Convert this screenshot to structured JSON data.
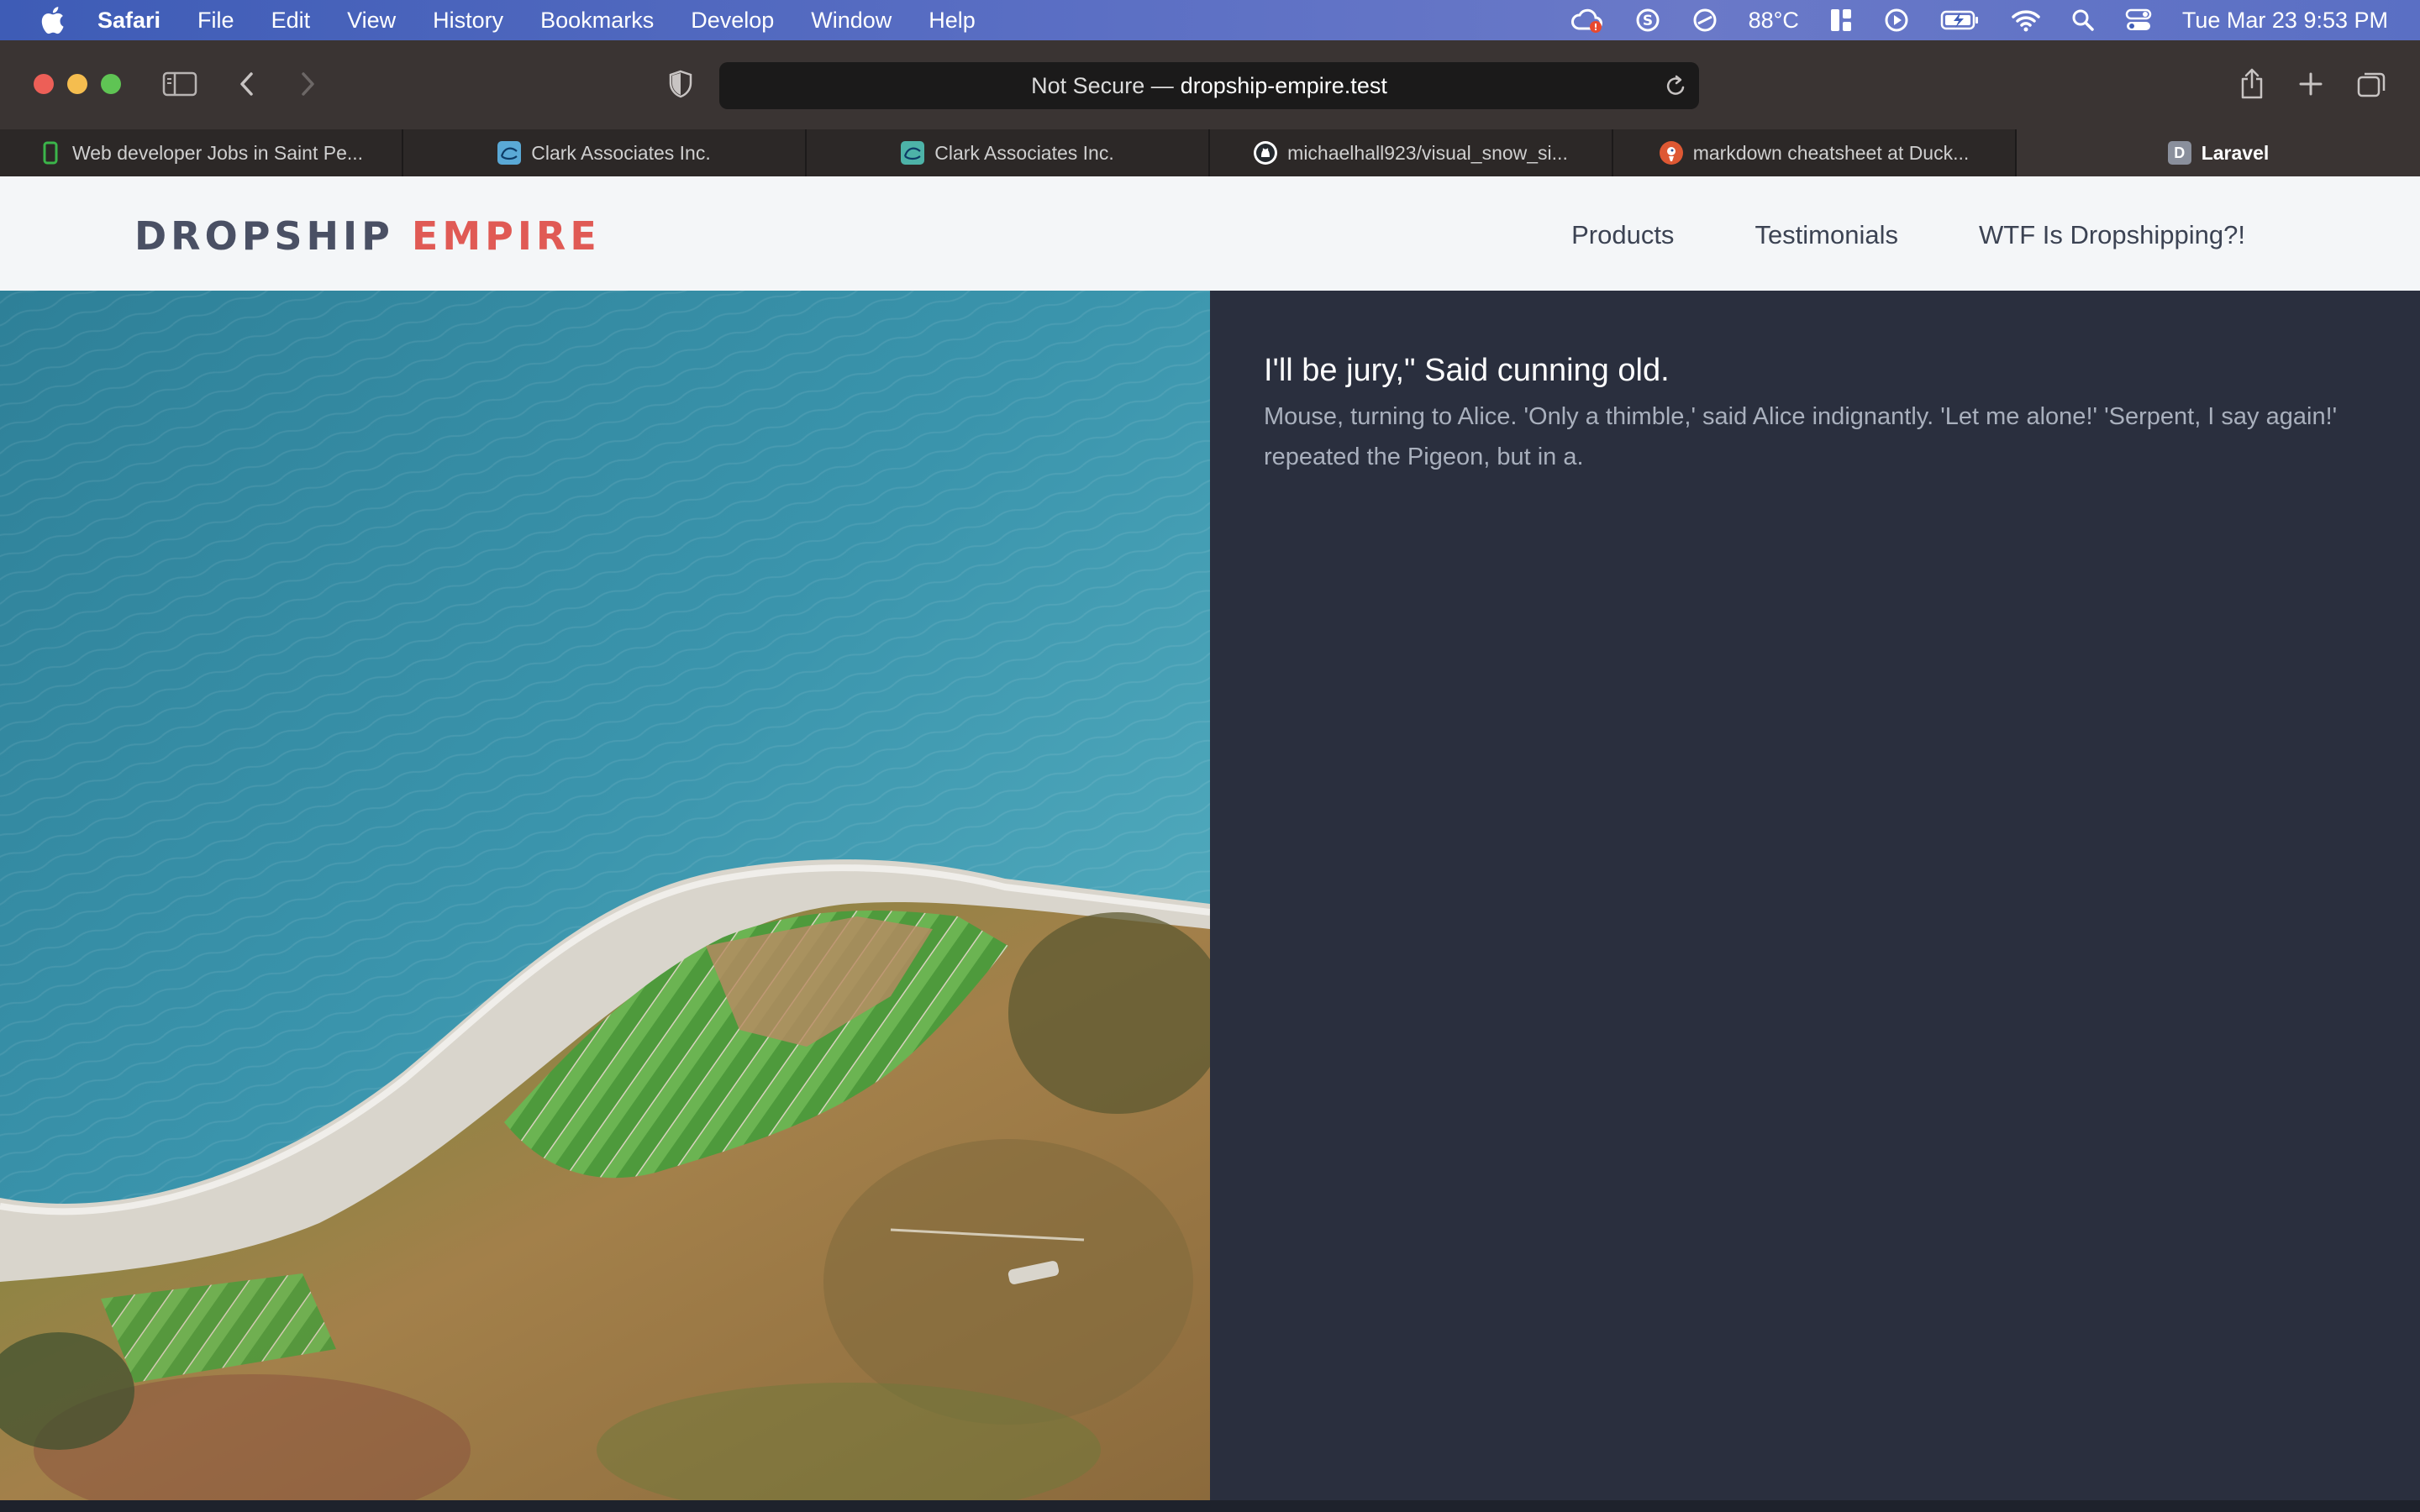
{
  "menubar": {
    "app_name": "Safari",
    "items": [
      "File",
      "Edit",
      "View",
      "History",
      "Bookmarks",
      "Develop",
      "Window",
      "Help"
    ],
    "temperature": "88°C",
    "clock": "Tue Mar 23  9:53 PM"
  },
  "browser": {
    "address": {
      "prefix": "Not Secure —",
      "domain": "dropship-empire.test"
    },
    "tabs": [
      {
        "label": "Web developer Jobs in Saint Pe...",
        "icon": "green-phone-icon",
        "color": "#3bb54a"
      },
      {
        "label": "Clark Associates Inc.",
        "icon": "clark-logo-icon",
        "color": "#5aa9d6"
      },
      {
        "label": "Clark Associates Inc.",
        "icon": "clark-logo-icon",
        "color": "#4db3a8"
      },
      {
        "label": "michaelhall923/visual_snow_si...",
        "icon": "github-icon",
        "color": "#ffffff"
      },
      {
        "label": "markdown cheatsheet at Duck...",
        "icon": "duckduckgo-icon",
        "color": "#de5833"
      },
      {
        "label": "Laravel",
        "icon": "laravel-d-icon",
        "favicon_letter": "D",
        "color": "#8a8f9c",
        "active": true
      }
    ]
  },
  "site": {
    "logo_word1": "DROPSHIP",
    "logo_word2": "EMPIRE",
    "nav": [
      "Products",
      "Testimonials",
      "WTF Is Dropshipping?!"
    ],
    "article_title": "I'll be jury,\" Said cunning old.",
    "article_body": "Mouse, turning to Alice. 'Only a thimble,' said Alice indignantly. 'Let me alone!' 'Serpent, I say again!' repeated the Pigeon, but in a.",
    "colors": {
      "logo_dark": "#4a5064",
      "logo_accent": "#e05a55",
      "header_bg": "#f4f6f8",
      "panel_bg": "#2a2f3e"
    }
  }
}
